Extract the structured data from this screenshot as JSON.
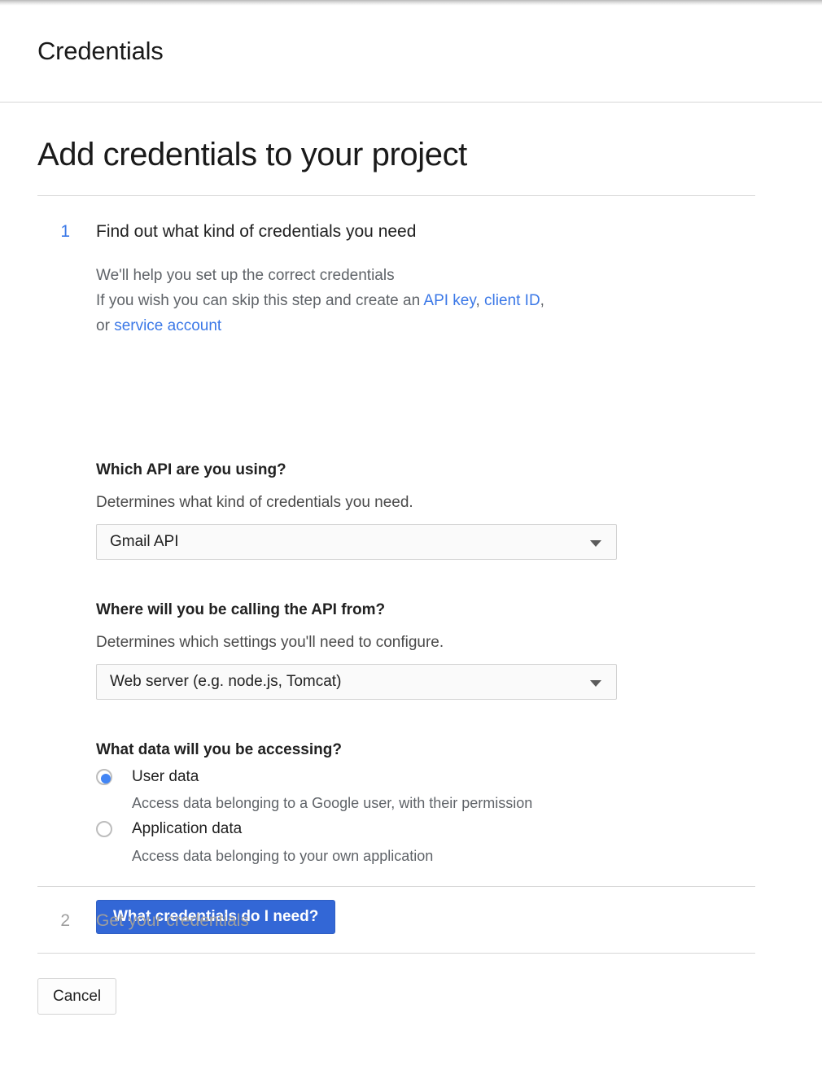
{
  "appbar": {
    "title": "Credentials"
  },
  "page": {
    "title": "Add credentials to your project"
  },
  "step1": {
    "number": "1",
    "heading": "Find out what kind of credentials you need",
    "intro_line1": "We'll help you set up the correct credentials",
    "intro_line2_prefix": "If you wish you can skip this step and create an ",
    "link_api_key": "API key",
    "intro_sep1": ", ",
    "link_client_id": "client ID",
    "intro_sep2": ",",
    "intro_line3_prefix": "or ",
    "link_service_account": "service account",
    "api_field": {
      "label": "Which API are you using?",
      "help": "Determines what kind of credentials you need.",
      "value": "Gmail API"
    },
    "where_field": {
      "label": "Where will you be calling the API from?",
      "help": "Determines which settings you'll need to configure.",
      "value": "Web server (e.g. node.js, Tomcat)"
    },
    "data_field": {
      "label": "What data will you be accessing?",
      "options": [
        {
          "label": "User data",
          "description": "Access data belonging to a Google user, with their permission",
          "selected": true
        },
        {
          "label": "Application data",
          "description": "Access data belonging to your own application",
          "selected": false
        }
      ]
    },
    "primary_button": "What credentials do I need?"
  },
  "step2": {
    "number": "2",
    "heading": "Get your credentials"
  },
  "footer": {
    "cancel_button": "Cancel"
  },
  "colors": {
    "accent_blue": "#3367d6",
    "link_blue": "#3b78e7",
    "radio_blue": "#4285f4",
    "muted_gray": "#9e9e9e",
    "divider": "#d7d7d7"
  }
}
